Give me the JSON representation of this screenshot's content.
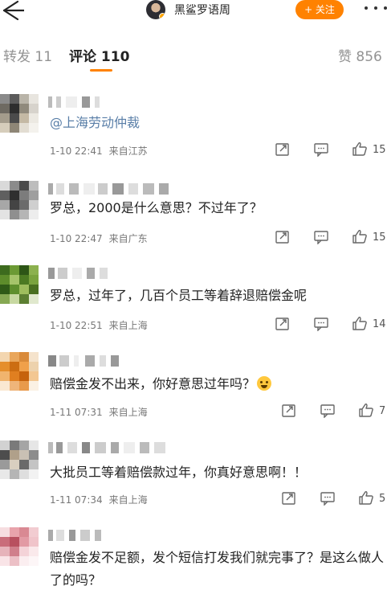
{
  "header": {
    "username": "黑鲨罗语周",
    "follow_label": "+ 关注"
  },
  "tabs": [
    {
      "label": "转发 11"
    },
    {
      "label": "评论 110"
    },
    {
      "label": "赞 856"
    }
  ],
  "comments": [
    {
      "text": "@上海劳动仲裁",
      "time": "1-10 22:41",
      "location": "来自江苏",
      "likes": "15"
    },
    {
      "text": "罗总，2000是什么意思？不过年了？",
      "time": "1-10 22:47",
      "location": "来自广东",
      "likes": "15"
    },
    {
      "text": "罗总，过年了，几百个员工等着辞退赔偿金呢",
      "time": "1-10 22:51",
      "location": "来自上海",
      "likes": "14"
    },
    {
      "text": "赔偿金发不出来，你好意思过年吗？",
      "time": "1-11 07:31",
      "location": "来自上海",
      "likes": "7"
    },
    {
      "text": "大批员工等着赔偿款过年，你真好意思啊！！",
      "time": "1-11 07:34",
      "location": "来自上海",
      "likes": "5"
    },
    {
      "text": "赔偿金发不足额，发个短信打发我们就完事了？是这么做人了的吗？",
      "time": "",
      "location": "",
      "likes": ""
    }
  ],
  "icons": {
    "back": "back-arrow-icon",
    "more": "more-dots-icon",
    "share": "share-icon",
    "comment": "comment-icon",
    "like": "like-thumb-icon"
  },
  "colors": {
    "accent": "#ff8200",
    "mention": "#5a7fa8"
  }
}
